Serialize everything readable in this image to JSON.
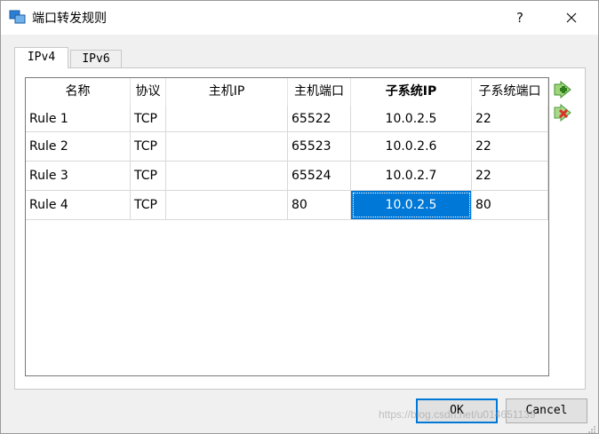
{
  "window": {
    "title": "端口转发规则",
    "help_label": "?",
    "icon": "virtualbox-app-icon"
  },
  "tabs": [
    {
      "label": "IPv4",
      "selected": true
    },
    {
      "label": "IPv6",
      "selected": false
    }
  ],
  "table": {
    "columns": [
      "名称",
      "协议",
      "主机IP",
      "主机端口",
      "子系统IP",
      "子系统端口"
    ],
    "rows": [
      {
        "name": "Rule 1",
        "protocol": "TCP",
        "host_ip": "",
        "host_port": "65522",
        "guest_ip": "10.0.2.5",
        "guest_port": "22"
      },
      {
        "name": "Rule 2",
        "protocol": "TCP",
        "host_ip": "",
        "host_port": "65523",
        "guest_ip": "10.0.2.6",
        "guest_port": "22"
      },
      {
        "name": "Rule 3",
        "protocol": "TCP",
        "host_ip": "",
        "host_port": "65524",
        "guest_ip": "10.0.2.7",
        "guest_port": "22"
      },
      {
        "name": "Rule 4",
        "protocol": "TCP",
        "host_ip": "",
        "host_port": "80",
        "guest_ip": "10.0.2.5",
        "guest_port": "80"
      }
    ],
    "selected_cell": {
      "row": 3,
      "column": "guest_ip"
    }
  },
  "side_actions": {
    "add_icon": "add-rule-icon",
    "remove_icon": "remove-rule-icon"
  },
  "buttons": {
    "ok": "OK",
    "cancel": "Cancel"
  },
  "watermark": "https://blog.csdn.net/u014651139",
  "colors": {
    "selection": "#0078d7",
    "default_button_border": "#0078d7",
    "window_bg": "#f0f0f0"
  }
}
